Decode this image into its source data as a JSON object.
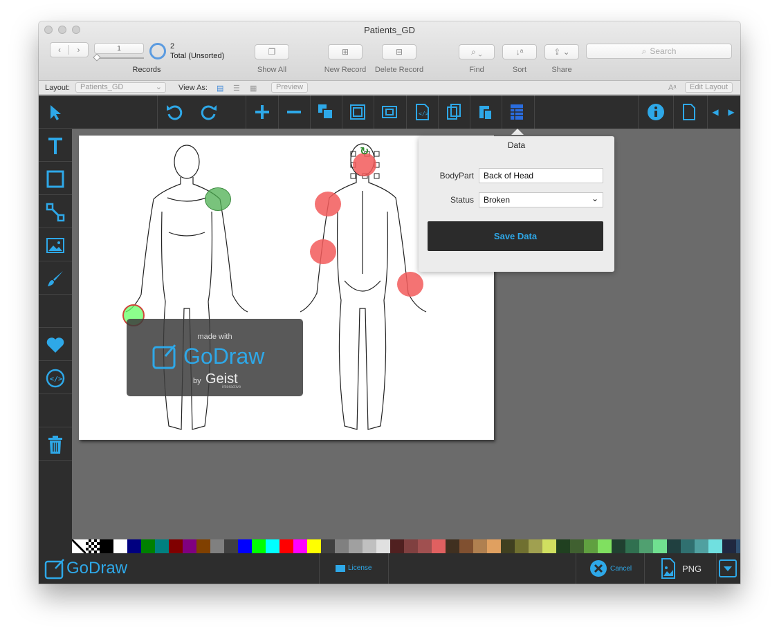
{
  "window": {
    "title": "Patients_GD"
  },
  "toolbar": {
    "record_number": "1",
    "found_count": "2",
    "total_label": "Total (Unsorted)",
    "records_label": "Records",
    "show_all_label": "Show All",
    "new_record_label": "New Record",
    "delete_record_label": "Delete Record",
    "find_label": "Find",
    "sort_label": "Sort",
    "share_label": "Share",
    "search_placeholder": "Search"
  },
  "layoutbar": {
    "layout_label": "Layout:",
    "layout_value": "Patients_GD",
    "view_as_label": "View As:",
    "preview_label": "Preview",
    "edit_layout_label": "Edit Layout"
  },
  "watermark": {
    "made_with": "made with",
    "brand": "GoDraw",
    "by": "by",
    "company": "Geist",
    "company_sub": "interactive"
  },
  "popover": {
    "title": "Data",
    "bodypart_label": "BodyPart",
    "bodypart_value": "Back of Head",
    "status_label": "Status",
    "status_value": "Broken",
    "save_label": "Save Data"
  },
  "bottombar": {
    "brand": "GoDraw",
    "license_label": "License",
    "cancel_label": "Cancel",
    "png_label": "PNG"
  },
  "colors": {
    "accent": "#2ea8e8",
    "panel_dark": "#2d2d2d",
    "marker_red": "#f25b5b",
    "marker_green": "#4caf50"
  },
  "palette": [
    "#ffffff",
    "#bfbfbf",
    "#000000",
    "#ffffff",
    "#000080",
    "#008000",
    "#008080",
    "#800000",
    "#800080",
    "#804000",
    "#808080",
    "#404040",
    "#0000ff",
    "#00ff00",
    "#00ffff",
    "#ff0000",
    "#ff00ff",
    "#ffff00",
    "#404040",
    "#808080",
    "#a0a0a0",
    "#c0c0c0",
    "#e0e0e0",
    "#502020",
    "#804040",
    "#a05050",
    "#e06060",
    "#403020",
    "#805030",
    "#b08050",
    "#e0a060",
    "#404020",
    "#707030",
    "#a0a050",
    "#d0e060",
    "#204020",
    "#406030",
    "#60a040",
    "#80e060",
    "#204030",
    "#307050",
    "#50a070",
    "#70e090",
    "#204040",
    "#307070",
    "#50a0a0",
    "#70e0e0",
    "#202840",
    "#305070"
  ]
}
